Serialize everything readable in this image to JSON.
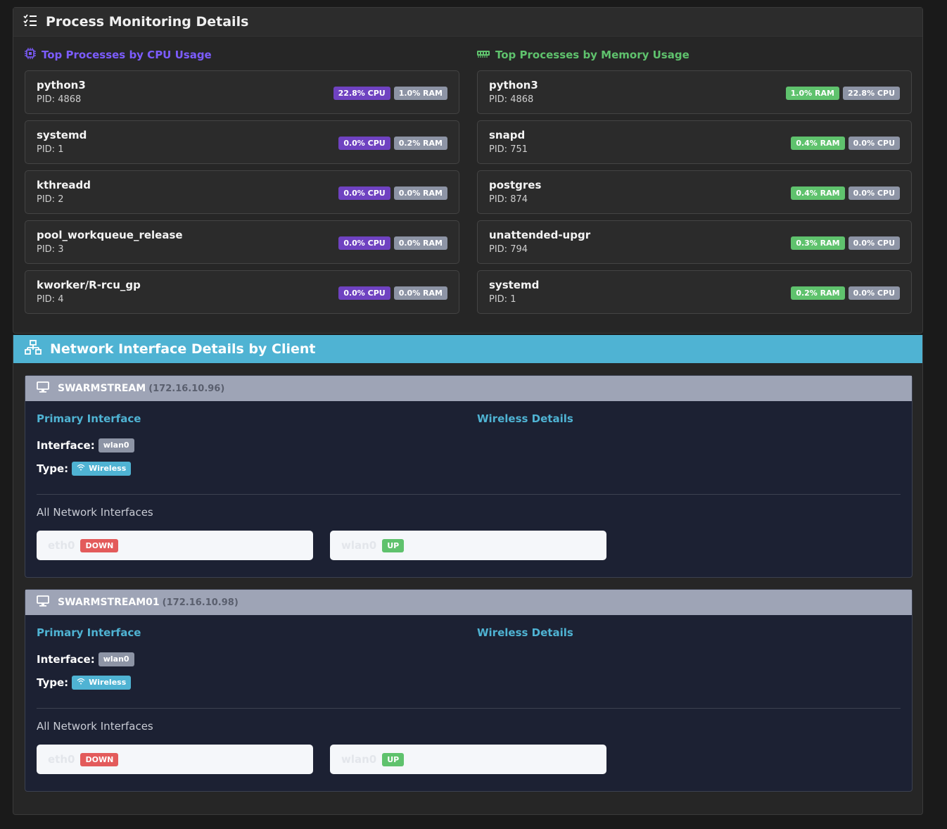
{
  "process_section": {
    "title": "Process Monitoring Details",
    "cpu_title": "Top Processes by CPU Usage",
    "mem_title": "Top Processes by Memory Usage",
    "cpu_processes": [
      {
        "name": "python3",
        "pid": "PID: 4868",
        "cpu": "22.8% CPU",
        "ram": "1.0% RAM"
      },
      {
        "name": "systemd",
        "pid": "PID: 1",
        "cpu": "0.0% CPU",
        "ram": "0.2% RAM"
      },
      {
        "name": "kthreadd",
        "pid": "PID: 2",
        "cpu": "0.0% CPU",
        "ram": "0.0% RAM"
      },
      {
        "name": "pool_workqueue_release",
        "pid": "PID: 3",
        "cpu": "0.0% CPU",
        "ram": "0.0% RAM"
      },
      {
        "name": "kworker/R-rcu_gp",
        "pid": "PID: 4",
        "cpu": "0.0% CPU",
        "ram": "0.0% RAM"
      }
    ],
    "mem_processes": [
      {
        "name": "python3",
        "pid": "PID: 4868",
        "ram": "1.0% RAM",
        "cpu": "22.8% CPU"
      },
      {
        "name": "snapd",
        "pid": "PID: 751",
        "ram": "0.4% RAM",
        "cpu": "0.0% CPU"
      },
      {
        "name": "postgres",
        "pid": "PID: 874",
        "ram": "0.4% RAM",
        "cpu": "0.0% CPU"
      },
      {
        "name": "unattended-upgr",
        "pid": "PID: 794",
        "ram": "0.3% RAM",
        "cpu": "0.0% CPU"
      },
      {
        "name": "systemd",
        "pid": "PID: 1",
        "ram": "0.2% RAM",
        "cpu": "0.0% CPU"
      }
    ]
  },
  "network_section": {
    "title": "Network Interface Details by Client",
    "clients": [
      {
        "name": "SWARMSTREAM",
        "ip": "(172.16.10.96)",
        "primary_title": "Primary Interface",
        "wireless_title": "Wireless Details",
        "interface_label": "Interface:",
        "interface_value": "wlan0",
        "type_label": "Type:",
        "type_value": "Wireless",
        "all_title": "All Network Interfaces",
        "interfaces": [
          {
            "name": "eth0",
            "status": "DOWN"
          },
          {
            "name": "wlan0",
            "status": "UP"
          }
        ]
      },
      {
        "name": "SWARMSTREAM01",
        "ip": "(172.16.10.98)",
        "primary_title": "Primary Interface",
        "wireless_title": "Wireless Details",
        "interface_label": "Interface:",
        "interface_value": "wlan0",
        "type_label": "Type:",
        "type_value": "Wireless",
        "all_title": "All Network Interfaces",
        "interfaces": [
          {
            "name": "eth0",
            "status": "DOWN"
          },
          {
            "name": "wlan0",
            "status": "UP"
          }
        ]
      }
    ]
  },
  "colors": {
    "cpu_accent": "#7c5cff",
    "mem_accent": "#5fc26d",
    "network_header": "#4fb3d3",
    "status_down": "#e35b5b",
    "status_up": "#5fc26d"
  },
  "icons": {
    "process_header": "list-check-icon",
    "cpu_title": "cpu-chip-icon",
    "mem_title": "memory-icon",
    "network_header": "network-icon",
    "client": "monitor-icon",
    "wireless": "wifi-icon"
  }
}
